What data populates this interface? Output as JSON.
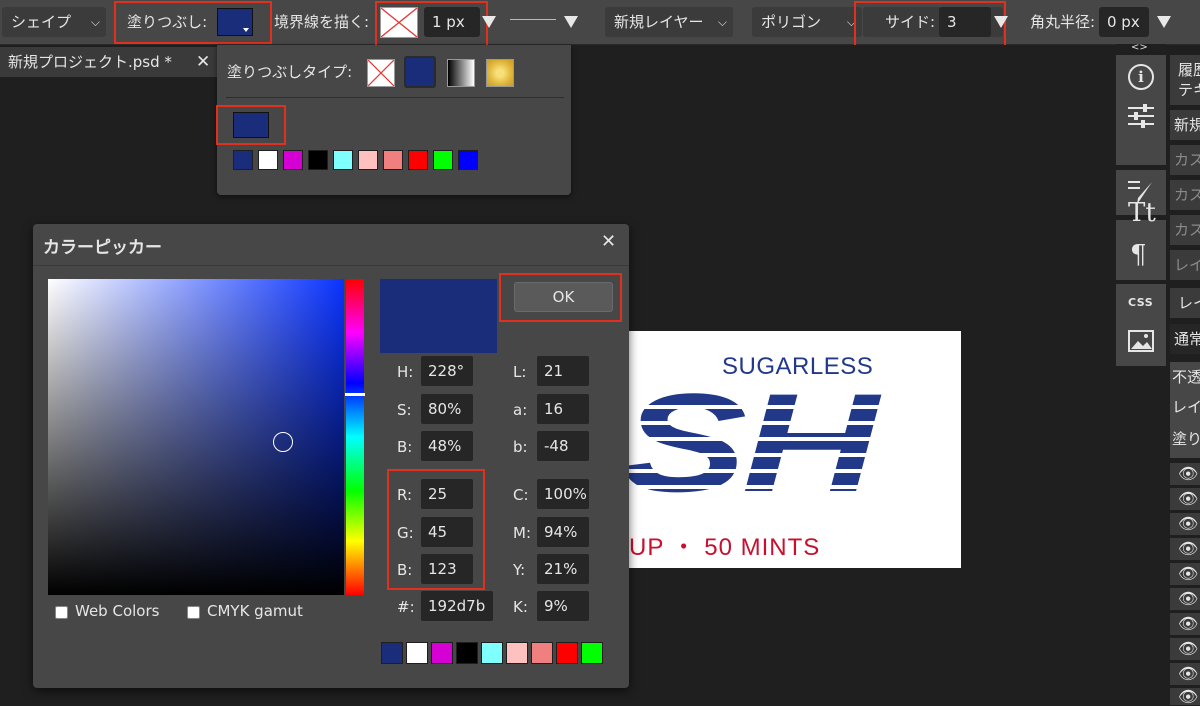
{
  "toolbar": {
    "shape_label": "シェイプ",
    "fill_label": "塗りつぶし:",
    "fill_color": "#192d7b",
    "stroke_label": "境界線を描く:",
    "stroke_width": "1 px",
    "layer_label": "新規レイヤー",
    "polygon_label": "ポリゴン",
    "sides_label": "サイド:",
    "sides_value": "3",
    "radius_label": "角丸半径:",
    "radius_value": "0 px"
  },
  "tab": {
    "title": "新規プロジェクト.psd *"
  },
  "fill_panel": {
    "type_label": "塗りつぶしタイプ:",
    "current_color": "#192d7b",
    "swatches": [
      "#192d7b",
      "#ffffff",
      "#d400d4",
      "#000000",
      "#80ffff",
      "#ffc0c0",
      "#f08080",
      "#ff0000",
      "#00ff00",
      "#0000ff"
    ]
  },
  "picker": {
    "title": "カラーピッカー",
    "ok_label": "OK",
    "preview_color": "#192d7b",
    "web_colors_label": "Web Colors",
    "cmyk_label": "CMYK gamut",
    "fields": {
      "h": {
        "label": "H:",
        "value": "228°"
      },
      "s": {
        "label": "S:",
        "value": "80%"
      },
      "bri": {
        "label": "B:",
        "value": "48%"
      },
      "r": {
        "label": "R:",
        "value": "25"
      },
      "g": {
        "label": "G:",
        "value": "45"
      },
      "b": {
        "label": "B:",
        "value": "123"
      },
      "hex": {
        "label": "#:",
        "value": "192d7b"
      },
      "l": {
        "label": "L:",
        "value": "21"
      },
      "a": {
        "label": "a:",
        "value": "16"
      },
      "lab_b": {
        "label": "b:",
        "value": "-48"
      },
      "c": {
        "label": "C:",
        "value": "100%"
      },
      "m": {
        "label": "M:",
        "value": "94%"
      },
      "y": {
        "label": "Y:",
        "value": "21%"
      },
      "k": {
        "label": "K:",
        "value": "9%"
      }
    },
    "swatches": [
      "#192d7b",
      "#ffffff",
      "#d400d4",
      "#000000",
      "#80ffff",
      "#ffc0c0",
      "#f08080",
      "#ff0000",
      "#00ff00"
    ]
  },
  "canvas": {
    "sugarless": "SUGARLESS",
    "logo_text": "SH",
    "bottom_text": "UP ・ 50 MINTS",
    "logo_color": "#22398a",
    "bottom_color": "#c8102e"
  },
  "right_panel": {
    "top_toggle": "<>",
    "items": [
      "履歴",
      "テキ",
      "新規",
      "カス",
      "カス",
      "カス",
      "レイ",
      "レイ",
      "通常",
      "不透",
      "レイ",
      "塗り"
    ],
    "css_label": "CSS"
  }
}
